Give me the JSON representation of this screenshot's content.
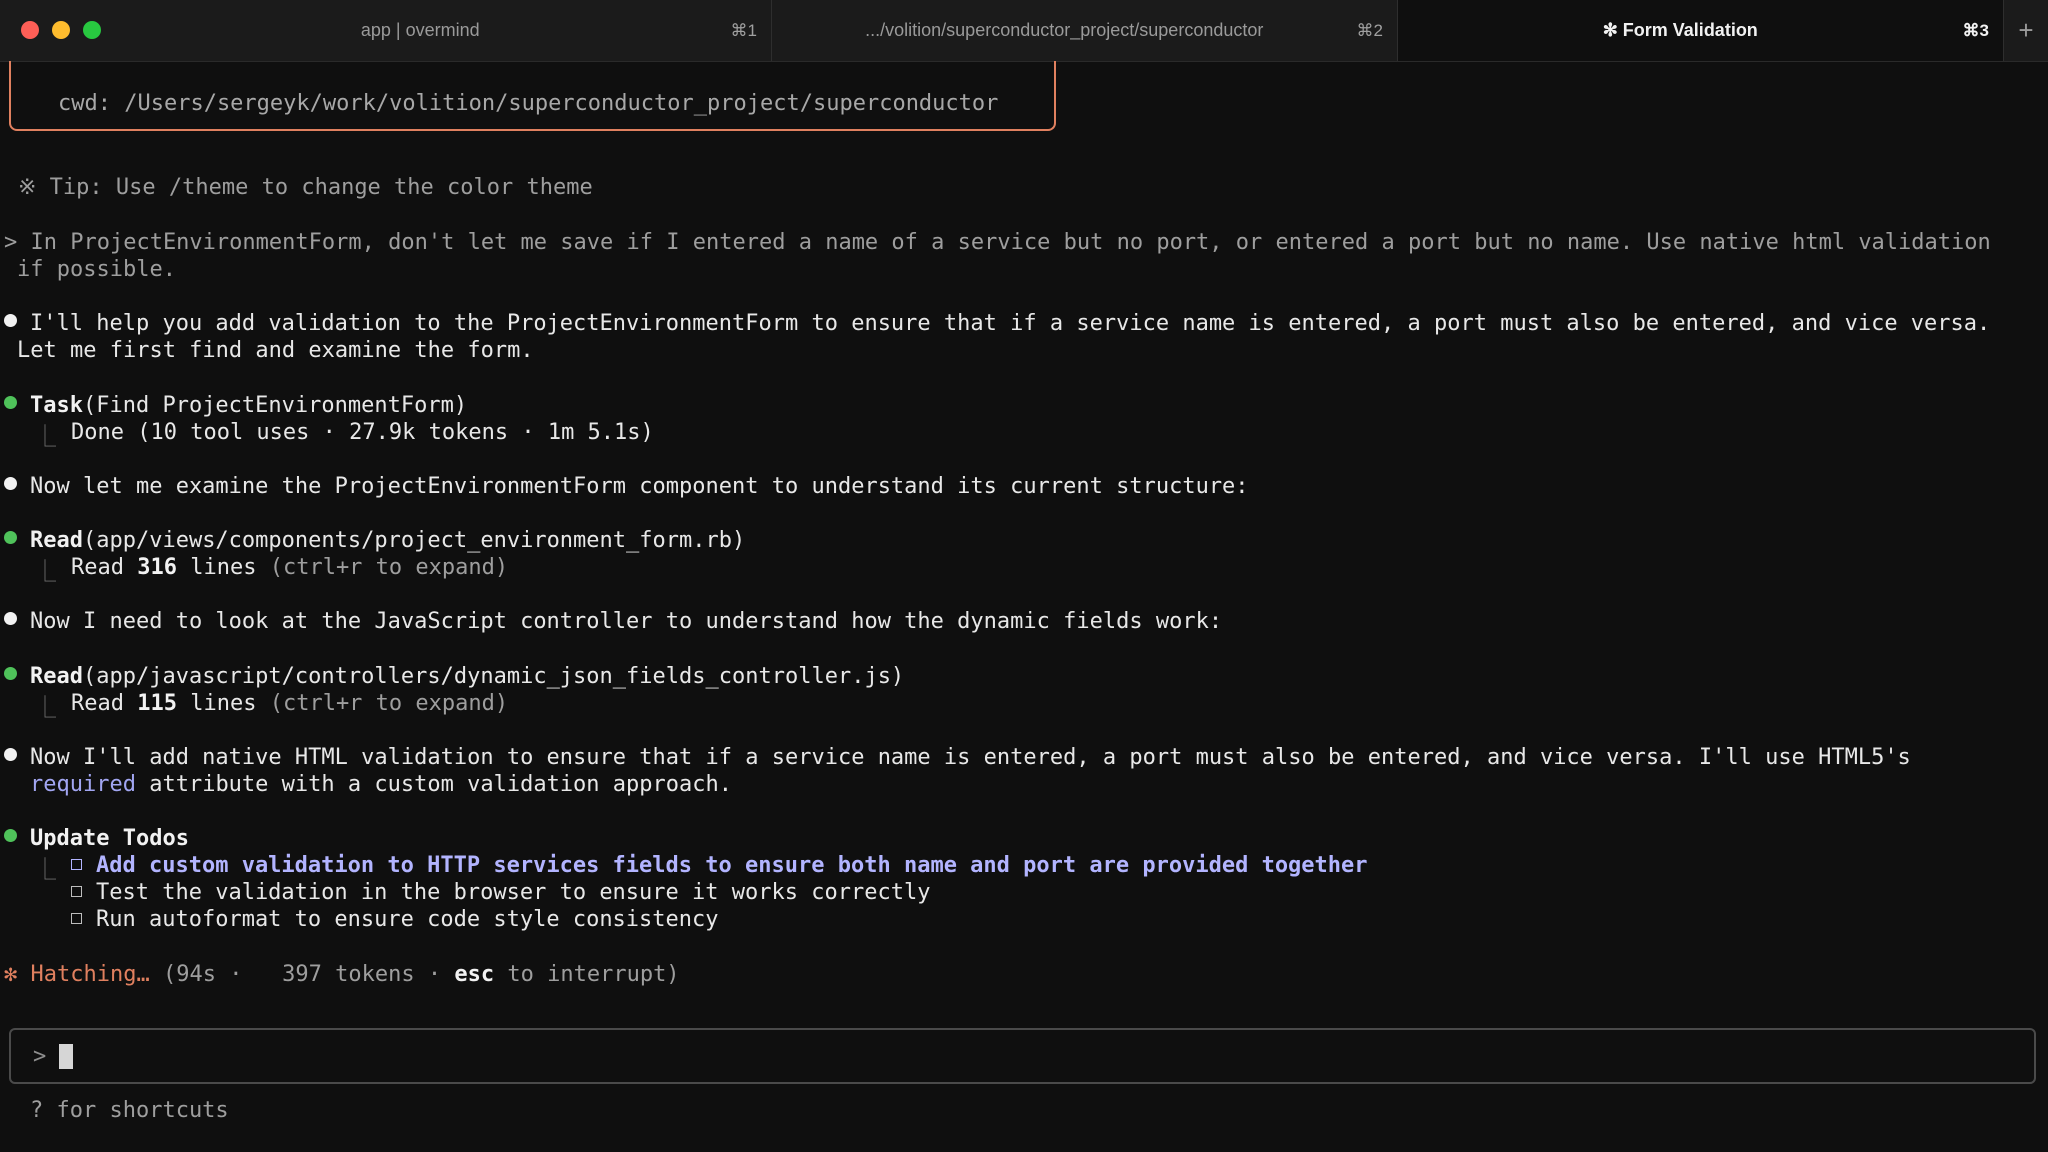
{
  "tabs": [
    {
      "title": "app | overmind",
      "shortcut": "⌘1",
      "active": false
    },
    {
      "title": ".../volition/superconductor_project/superconductor",
      "shortcut": "⌘2",
      "active": false
    },
    {
      "title": "✻ Form Validation",
      "shortcut": "⌘3",
      "active": true
    }
  ],
  "new_tab_icon": "+",
  "colors": {
    "accent_orange": "#e0805f",
    "green_dot": "#4fc25a",
    "purple": "#b2b4ff",
    "background": "#0f0f0f"
  },
  "terminal": {
    "cwd": "cwd: /Users/sergeyk/work/volition/superconductor_project/superconductor",
    "tip": "※ Tip: Use /theme to change the color theme",
    "user_prompt_line1": "> In ProjectEnvironmentForm, don't let me save if I entered a name of a service but no port, or entered a port but no name. Use native html validation",
    "user_prompt_line2": "if possible.",
    "msg1_line1": "I'll help you add validation to the ProjectEnvironmentForm to ensure that if a service name is entered, a port must also be entered, and vice versa.",
    "msg1_line2": "Let me first find and examine the form.",
    "task_name": "Task",
    "task_arg": "(Find ProjectEnvironmentForm)",
    "task_result": "Done (10 tool uses · 27.9k tokens · 1m 5.1s)",
    "msg2": "Now let me examine the ProjectEnvironmentForm component to understand its current structure:",
    "read1_name": "Read",
    "read1_arg": "(app/views/components/project_environment_form.rb)",
    "read1_prefix": "Read ",
    "read1_lines": "316",
    "read1_suffix": " lines",
    "read1_hint": " (ctrl+r to expand)",
    "msg3": "Now I need to look at the JavaScript controller to understand how the dynamic fields work:",
    "read2_name": "Read",
    "read2_arg": "(app/javascript/controllers/dynamic_json_fields_controller.js)",
    "read2_prefix": "Read ",
    "read2_lines": "115",
    "read2_suffix": " lines",
    "read2_hint": " (ctrl+r to expand)",
    "msg4_line1": "Now I'll add native HTML validation to ensure that if a service name is entered, a port must also be entered, and vice versa. I'll use HTML5's",
    "msg4_required": "required",
    "msg4_line2_rest": " attribute with a custom validation approach.",
    "todos_title": "Update Todos",
    "todos": [
      "Add custom validation to HTTP services fields to ensure both name and port are provided together",
      "Test the validation in the browser to ensure it works correctly",
      "Run autoformat to ensure code style consistency"
    ],
    "status_star": "✻",
    "status_word": "Hatching…",
    "status_time": " (94s ·  ",
    "status_tokens": " 397 tokens · ",
    "status_key": "esc",
    "status_tail": " to interrupt)",
    "input_prompt": ">",
    "shortcuts_hint": "? for shortcuts"
  }
}
